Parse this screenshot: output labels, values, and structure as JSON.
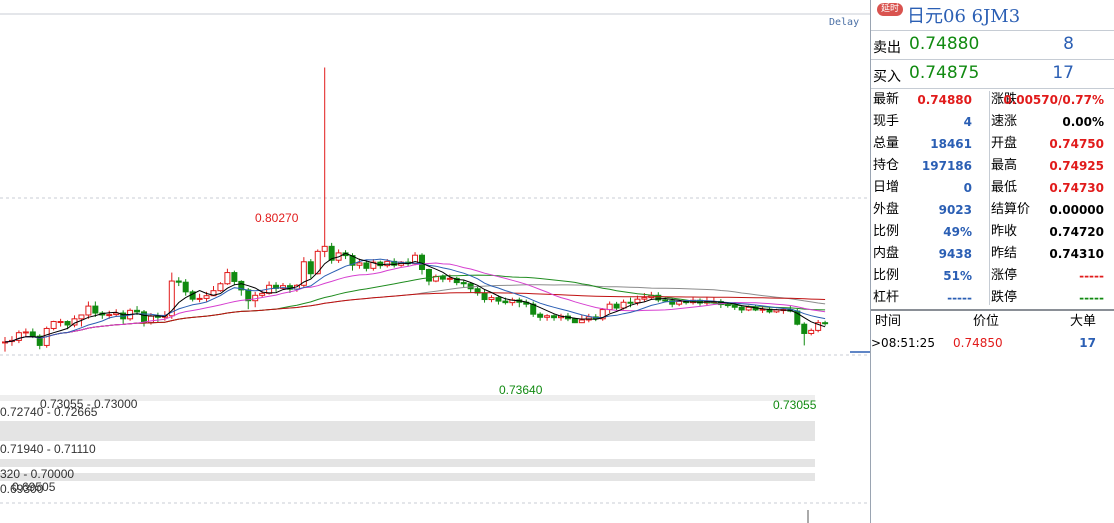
{
  "chart": {
    "delay_label": "Delay",
    "y_range": [
      0.6905,
      0.8145
    ],
    "candles": [
      [
        0.7313,
        0.7315,
        0.729,
        0.7328
      ],
      [
        0.7316,
        0.7319,
        0.7305,
        0.733
      ],
      [
        0.7319,
        0.7339,
        0.7312,
        0.7345
      ],
      [
        0.7339,
        0.7341,
        0.733,
        0.735
      ],
      [
        0.7341,
        0.733,
        0.7325,
        0.735
      ],
      [
        0.733,
        0.7306,
        0.7296,
        0.7335
      ],
      [
        0.7306,
        0.735,
        0.73,
        0.7355
      ],
      [
        0.735,
        0.7368,
        0.7345,
        0.737
      ],
      [
        0.7368,
        0.7368,
        0.7355,
        0.7375
      ],
      [
        0.7368,
        0.7359,
        0.7348,
        0.7371
      ],
      [
        0.7359,
        0.7375,
        0.7353,
        0.7384
      ],
      [
        0.7375,
        0.7385,
        0.7355,
        0.7385
      ],
      [
        0.7385,
        0.7408,
        0.7375,
        0.742
      ],
      [
        0.7408,
        0.739,
        0.738,
        0.742
      ],
      [
        0.739,
        0.7385,
        0.7375,
        0.7395
      ],
      [
        0.7385,
        0.7386,
        0.7375,
        0.7396
      ],
      [
        0.7386,
        0.739,
        0.738,
        0.74
      ],
      [
        0.739,
        0.7375,
        0.7362,
        0.7397
      ],
      [
        0.7375,
        0.7397,
        0.737,
        0.7402
      ],
      [
        0.7397,
        0.7393,
        0.7385,
        0.7408
      ],
      [
        0.7393,
        0.7365,
        0.7355,
        0.7398
      ],
      [
        0.7365,
        0.7382,
        0.736,
        0.739
      ],
      [
        0.7382,
        0.7379,
        0.7365,
        0.7391
      ],
      [
        0.7379,
        0.7383,
        0.737,
        0.7395
      ],
      [
        0.7383,
        0.7473,
        0.7375,
        0.7495
      ],
      [
        0.7473,
        0.747,
        0.746,
        0.7483
      ],
      [
        0.747,
        0.7445,
        0.7435,
        0.7478
      ],
      [
        0.7445,
        0.7426,
        0.742,
        0.745
      ],
      [
        0.7426,
        0.7428,
        0.7418,
        0.744
      ],
      [
        0.7428,
        0.7435,
        0.742,
        0.7445
      ],
      [
        0.7435,
        0.7448,
        0.7435,
        0.746
      ],
      [
        0.7448,
        0.7466,
        0.7445,
        0.747
      ],
      [
        0.7466,
        0.7495,
        0.7463,
        0.7505
      ],
      [
        0.7495,
        0.7472,
        0.7462,
        0.75
      ],
      [
        0.7472,
        0.745,
        0.7435,
        0.7475
      ],
      [
        0.745,
        0.7422,
        0.74,
        0.7455
      ],
      [
        0.7422,
        0.7436,
        0.7405,
        0.7445
      ],
      [
        0.7436,
        0.7441,
        0.743,
        0.7449
      ],
      [
        0.7441,
        0.7462,
        0.7438,
        0.7472
      ],
      [
        0.7462,
        0.7454,
        0.7445,
        0.747
      ],
      [
        0.7454,
        0.7461,
        0.745,
        0.7468
      ],
      [
        0.7461,
        0.7452,
        0.7442,
        0.7467
      ],
      [
        0.7452,
        0.7462,
        0.7445,
        0.7465
      ],
      [
        0.7462,
        0.7523,
        0.7455,
        0.7535
      ],
      [
        0.7523,
        0.7492,
        0.748,
        0.753
      ],
      [
        0.7492,
        0.755,
        0.749,
        0.7555
      ],
      [
        0.755,
        0.7563,
        0.7535,
        0.8027
      ],
      [
        0.7563,
        0.7527,
        0.7518,
        0.7572
      ],
      [
        0.7527,
        0.7546,
        0.752,
        0.7555
      ],
      [
        0.7546,
        0.7539,
        0.753,
        0.7553
      ],
      [
        0.7539,
        0.7514,
        0.75,
        0.7545
      ],
      [
        0.7514,
        0.752,
        0.7505,
        0.7531
      ],
      [
        0.752,
        0.7506,
        0.7498,
        0.7527
      ],
      [
        0.7506,
        0.7522,
        0.75,
        0.753
      ],
      [
        0.7522,
        0.7513,
        0.7505,
        0.7526
      ],
      [
        0.7513,
        0.7524,
        0.7508,
        0.753
      ],
      [
        0.7524,
        0.7514,
        0.7508,
        0.7532
      ],
      [
        0.7514,
        0.7522,
        0.751,
        0.7525
      ],
      [
        0.7522,
        0.7518,
        0.7511,
        0.7532
      ],
      [
        0.7518,
        0.754,
        0.7514,
        0.7548
      ],
      [
        0.754,
        0.7503,
        0.749,
        0.7545
      ],
      [
        0.7503,
        0.7473,
        0.7462,
        0.7505
      ],
      [
        0.7473,
        0.7485,
        0.747,
        0.749
      ],
      [
        0.7485,
        0.7478,
        0.747,
        0.749
      ],
      [
        0.7478,
        0.748,
        0.747,
        0.749
      ],
      [
        0.748,
        0.7469,
        0.7462,
        0.7484
      ],
      [
        0.7469,
        0.7466,
        0.7455,
        0.7477
      ],
      [
        0.7466,
        0.7453,
        0.7444,
        0.747
      ],
      [
        0.7453,
        0.7442,
        0.7435,
        0.7458
      ],
      [
        0.7442,
        0.7425,
        0.7417,
        0.7451
      ],
      [
        0.7425,
        0.743,
        0.7418,
        0.7436
      ],
      [
        0.743,
        0.7421,
        0.7412,
        0.7436
      ],
      [
        0.7421,
        0.7417,
        0.7412,
        0.743
      ],
      [
        0.7417,
        0.7424,
        0.7409,
        0.743
      ],
      [
        0.7424,
        0.7418,
        0.7405,
        0.743
      ],
      [
        0.7418,
        0.7413,
        0.7405,
        0.7425
      ],
      [
        0.7413,
        0.7387,
        0.738,
        0.742
      ],
      [
        0.7387,
        0.7379,
        0.737,
        0.7392
      ],
      [
        0.7379,
        0.7383,
        0.737,
        0.7387
      ],
      [
        0.7383,
        0.7378,
        0.737,
        0.7387
      ],
      [
        0.7378,
        0.7382,
        0.737,
        0.7388
      ],
      [
        0.7382,
        0.7375,
        0.7369,
        0.739
      ],
      [
        0.7375,
        0.7365,
        0.7364,
        0.7378
      ],
      [
        0.7365,
        0.7372,
        0.7364,
        0.7386
      ],
      [
        0.7372,
        0.738,
        0.7366,
        0.7388
      ],
      [
        0.738,
        0.7375,
        0.7369,
        0.7387
      ],
      [
        0.7375,
        0.7399,
        0.737,
        0.7403
      ],
      [
        0.7399,
        0.7413,
        0.739,
        0.742
      ],
      [
        0.7413,
        0.7403,
        0.7397,
        0.7419
      ],
      [
        0.7403,
        0.7418,
        0.7399,
        0.7425
      ],
      [
        0.7418,
        0.7417,
        0.7405,
        0.743
      ],
      [
        0.7417,
        0.7426,
        0.741,
        0.7435
      ],
      [
        0.7426,
        0.743,
        0.742,
        0.7442
      ],
      [
        0.743,
        0.7436,
        0.7425,
        0.7445
      ],
      [
        0.7436,
        0.7424,
        0.7418,
        0.7444
      ],
      [
        0.7424,
        0.7422,
        0.7418,
        0.743
      ],
      [
        0.7422,
        0.7413,
        0.7405,
        0.7429
      ],
      [
        0.7413,
        0.742,
        0.7408,
        0.7424
      ],
      [
        0.742,
        0.7417,
        0.7412,
        0.7424
      ],
      [
        0.7417,
        0.7423,
        0.7412,
        0.7432
      ],
      [
        0.7423,
        0.7416,
        0.7409,
        0.7428
      ],
      [
        0.7416,
        0.742,
        0.741,
        0.7432
      ],
      [
        0.742,
        0.742,
        0.7414,
        0.743
      ],
      [
        0.742,
        0.7412,
        0.7403,
        0.7426
      ],
      [
        0.7412,
        0.7411,
        0.7404,
        0.7417
      ],
      [
        0.7411,
        0.7405,
        0.7398,
        0.7416
      ],
      [
        0.7405,
        0.7398,
        0.739,
        0.741
      ],
      [
        0.7398,
        0.7405,
        0.7395,
        0.741
      ],
      [
        0.7405,
        0.7398,
        0.7395,
        0.7411
      ],
      [
        0.7398,
        0.74,
        0.739,
        0.7408
      ],
      [
        0.74,
        0.7393,
        0.7389,
        0.7406
      ],
      [
        0.7393,
        0.7398,
        0.739,
        0.7401
      ],
      [
        0.7398,
        0.7399,
        0.7388,
        0.7404
      ],
      [
        0.7399,
        0.7395,
        0.7392,
        0.7408
      ],
      [
        0.7395,
        0.7361,
        0.7358,
        0.7401
      ],
      [
        0.7361,
        0.7337,
        0.7306,
        0.7366
      ],
      [
        0.7337,
        0.7345,
        0.7332,
        0.735
      ],
      [
        0.7345,
        0.7365,
        0.734,
        0.7372
      ],
      [
        0.7365,
        0.7364,
        0.7357,
        0.737
      ]
    ],
    "price_labels": {
      "high": "0.80270",
      "low1": "0.73640",
      "low2": "0.73055"
    },
    "zones": [
      "0.73055 - 0.73000",
      "0.72740 - 0.72665",
      "0.71940 - 0.71110",
      "320 - 0.70000",
      "0.69505",
      "0.69300"
    ]
  },
  "panel": {
    "badge": "延时",
    "title": "日元06  6JM3",
    "sell": {
      "label": "卖出",
      "price": "0.74880",
      "vol": "8"
    },
    "buy": {
      "label": "买入",
      "price": "0.74875",
      "vol": "17"
    },
    "stats": [
      {
        "k1": "最新",
        "v1": "0.74880",
        "c1": "red",
        "k2": "涨跌",
        "v2": "0.00570/0.77%",
        "c2": "red"
      },
      {
        "k1": "现手",
        "v1": "4",
        "c1": "blue",
        "k2": "速涨",
        "v2": "0.00%",
        "c2": "black"
      },
      {
        "k1": "总量",
        "v1": "18461",
        "c1": "blue",
        "k2": "开盘",
        "v2": "0.74750",
        "c2": "red"
      },
      {
        "k1": "持仓",
        "v1": "197186",
        "c1": "blue",
        "k2": "最高",
        "v2": "0.74925",
        "c2": "red"
      },
      {
        "k1": "日增",
        "v1": "0",
        "c1": "blue",
        "k2": "最低",
        "v2": "0.74730",
        "c2": "red"
      },
      {
        "k1": "外盘",
        "v1": "9023",
        "c1": "blue",
        "k2": "结算价",
        "v2": "0.00000",
        "c2": "black"
      },
      {
        "k1": "比例",
        "v1": "49%",
        "c1": "blue",
        "k2": "昨收",
        "v2": "0.74720",
        "c2": "black"
      },
      {
        "k1": "内盘",
        "v1": "9438",
        "c1": "blue",
        "k2": "昨结",
        "v2": "0.74310",
        "c2": "black"
      },
      {
        "k1": "比例",
        "v1": "51%",
        "c1": "blue",
        "k2": "涨停",
        "v2": "-----",
        "c2": "red"
      },
      {
        "k1": "杠杆",
        "v1": "-----",
        "c1": "blue",
        "k2": "跌停",
        "v2": "-----",
        "c2": "green"
      }
    ],
    "ticks_header": {
      "time": "时间",
      "price": "价位",
      "vol": "大单"
    },
    "ticks": [
      {
        "time": "08:51:25",
        "price": "0.74850",
        "vol": "17"
      }
    ],
    "colors": {
      "up": "#e11b1b",
      "down": "#118a11",
      "blue": "#2b5fb4",
      "ma5": "#000000",
      "ma10": "#2b5fb4",
      "ma20": "#d63fd0",
      "ma40": "#1f8c1f",
      "ma60": "#8c8c8c",
      "ma120": "#c01010"
    }
  }
}
